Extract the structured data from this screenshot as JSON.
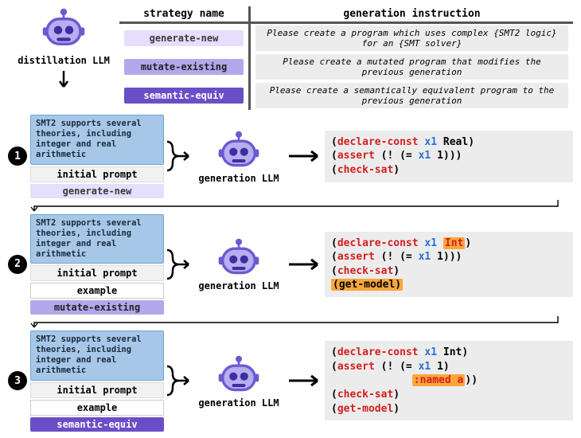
{
  "header": {
    "distillation_label": "distillation LLM",
    "col_strategy": "strategy name",
    "col_instruction": "generation instruction",
    "rows": [
      {
        "chip": "generate-new",
        "chip_cls": "c-new",
        "instr": "Please create a program which uses complex {SMT2 logic} for an {SMT solver}"
      },
      {
        "chip": "mutate-existing",
        "chip_cls": "c-mut",
        "instr": "Please create a mutated program that modifies the previous generation"
      },
      {
        "chip": "semantic-equiv",
        "chip_cls": "c-sem",
        "instr": "Please create a semantically equivalent program to the previous generation"
      }
    ]
  },
  "prompt_blurb": "SMT2 supports several theories, including integer and real arithmetic",
  "initial_prompt_label": "initial prompt",
  "example_label": "example",
  "generation_llm_label": "generation LLM",
  "stages": [
    {
      "n": "1",
      "has_example": false,
      "chip": "generate-new",
      "chip_cls": "c-new",
      "code": "(<span class='kw'>declare-const</span> <span class='id'>x1</span> Real)\n(<span class='kw'>assert</span> (! (= <span class='id'>x1</span> 1)))\n(<span class='kw'>check-sat</span>)"
    },
    {
      "n": "2",
      "has_example": true,
      "chip": "mutate-existing",
      "chip_cls": "c-mut",
      "code": "(<span class='kw'>declare-const</span> <span class='id'>x1</span> <span class='ty'>Int</span>)\n(<span class='kw'>assert</span> (! (= <span class='id'>x1</span> 1)))\n(<span class='kw'>check-sat</span>)\n<span class='hl'>(get-model)</span>"
    },
    {
      "n": "3",
      "has_example": true,
      "chip": "semantic-equiv",
      "chip_cls": "c-sem",
      "code": "(<span class='kw'>declare-const</span> <span class='id'>x1</span> Int)\n(<span class='kw'>assert</span> (! (= <span class='id'>x1</span> 1)\n             <span class='nm'>:named a</span>))\n(<span class='kw'>check-sat</span>)\n(<span class='kw'>get-model</span>)"
    }
  ]
}
